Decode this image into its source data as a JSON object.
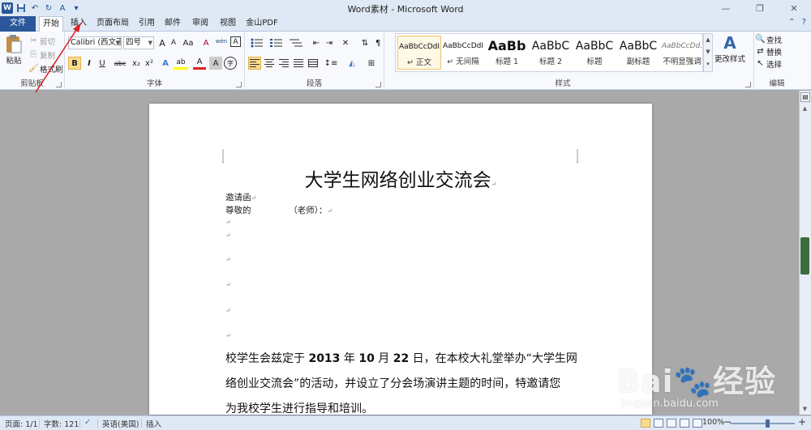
{
  "window": {
    "title": "Word素材 - Microsoft Word",
    "minimize": "—",
    "restore": "❐",
    "close": "✕"
  },
  "qat": {
    "undo": "↶",
    "redo": "↻",
    "format": "A",
    "customize": "▾"
  },
  "tabs": [
    "文件",
    "开始",
    "插入",
    "页面布局",
    "引用",
    "邮件",
    "审阅",
    "视图",
    "金山PDF"
  ],
  "tab_right": {
    "help": "?",
    "collapse": "⌃"
  },
  "clipboard": {
    "paste": "粘贴",
    "cut": "剪切",
    "copy": "复制",
    "format_painter": "格式刷",
    "label": "剪贴板"
  },
  "font": {
    "name": "Calibri (西文正",
    "size": "四号",
    "grow": "A",
    "shrink": "A",
    "case": "Aa",
    "clear": "A",
    "phonetic": "wén",
    "border_char": "A",
    "bold": "B",
    "italic": "I",
    "underline": "U",
    "strike": "abc",
    "subscript": "x₂",
    "superscript": "x²",
    "effects": "A",
    "highlight": "ab",
    "color": "A",
    "shade": "A",
    "enclose": "字",
    "label": "字体"
  },
  "paragraph": {
    "label": "段落"
  },
  "styles": {
    "items": [
      {
        "preview": "AaBbCcDdI",
        "name": "↵ 正文"
      },
      {
        "preview": "AaBbCcDdI",
        "name": "↵ 无间隔"
      },
      {
        "preview": "AaBb",
        "name": "标题 1"
      },
      {
        "preview": "AaBbC",
        "name": "标题 2"
      },
      {
        "preview": "AaBbC",
        "name": "标题"
      },
      {
        "preview": "AaBbC",
        "name": "副标题"
      },
      {
        "preview": "AaBbCcDd.",
        "name": "不明显强调"
      }
    ],
    "change": "更改样式",
    "label": "样式"
  },
  "editing": {
    "find": "查找",
    "replace": "替换",
    "select": "选择",
    "label": "编辑"
  },
  "document": {
    "title": "大学生网络创业交流会",
    "line1": "邀请函",
    "line2_a": "尊敬的",
    "line2_b": "（老师）：",
    "body_1": "校学生会兹定于 ",
    "year": "2013",
    "body_2": " 年 ",
    "month": "10",
    "body_3": " 月 ",
    "day": "22",
    "body_4": " 日，在本校大礼堂举办“大学生网",
    "body_line2": "络创业交流会”的活动，并设立了分会场演讲主题的时间，特邀请您",
    "body_line3": "为我校学生进行指导和培训。",
    "para_mark": "↵"
  },
  "status": {
    "page": "页面: 1/1",
    "words": "字数: 121",
    "language": "英语(美国)",
    "mode": "插入",
    "zoom": "100%",
    "zoom_out": "−",
    "zoom_in": "+"
  },
  "watermark": {
    "main": "Bai🐾经验",
    "sub": "jingyan.baidu.com"
  }
}
